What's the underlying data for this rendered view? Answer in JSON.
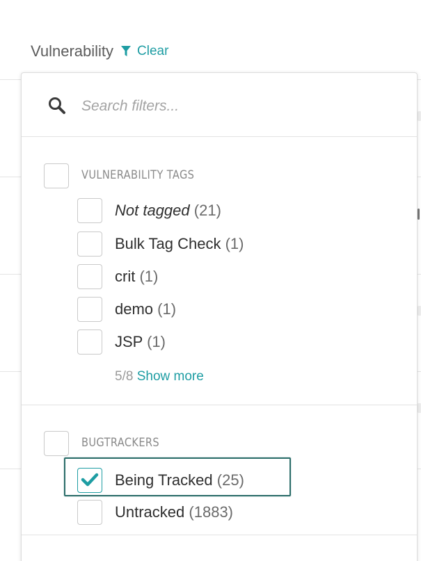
{
  "column": {
    "title": "Vulnerability",
    "clear_label": "Clear"
  },
  "colors": {
    "accent": "#1e9da3",
    "highlight_border": "#2b6d69"
  },
  "search": {
    "placeholder": "Search filters...",
    "value": ""
  },
  "groups": [
    {
      "label": "VULNERABILITY TAGS",
      "checked": false,
      "items": [
        {
          "label": "Not tagged",
          "count": "(21)",
          "italic": true,
          "checked": false
        },
        {
          "label": "Bulk Tag Check",
          "count": "(1)",
          "checked": false
        },
        {
          "label": "crit",
          "count": "(1)",
          "checked": false
        },
        {
          "label": "demo",
          "count": "(1)",
          "checked": false
        },
        {
          "label": "JSP",
          "count": "(1)",
          "checked": false
        }
      ],
      "shown": "5/8",
      "show_more_label": "Show more"
    },
    {
      "label": "BUGTRACKERS",
      "checked": false,
      "items": [
        {
          "label": "Being Tracked",
          "count": "(25)",
          "checked": true,
          "highlighted": true
        },
        {
          "label": "Untracked",
          "count": "(1883)",
          "checked": false
        }
      ]
    }
  ],
  "icons": {
    "filter": "filter-icon",
    "search": "search-icon",
    "check": "check-icon"
  }
}
